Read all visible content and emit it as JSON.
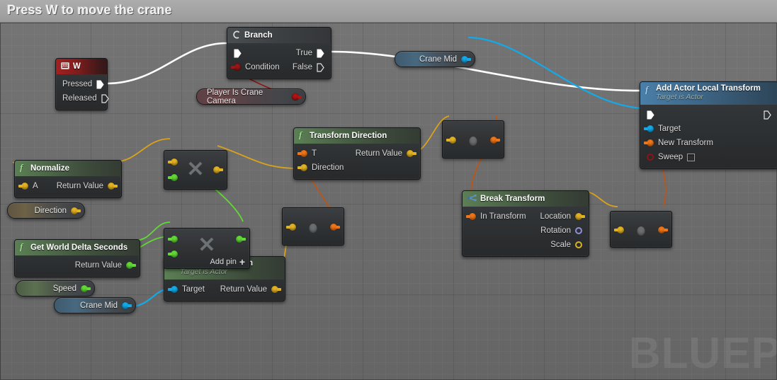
{
  "window": {
    "title": "Press W to move the crane"
  },
  "canvas": {
    "watermark": "BLUEP"
  },
  "palette": {
    "exec_white": "#ffffff",
    "bool_red": "#9c1616",
    "vector_yellow": "#e3b223",
    "float_green": "#62d936",
    "object_blue": "#14a9e8",
    "transform_orange": "#ef7518",
    "rotator_purple": "#8f8fd8",
    "node_header_green": "#5c7f55",
    "node_header_blue": "#4a7fa8",
    "node_header_red": "#a32020"
  },
  "nodes": {
    "event_w": {
      "title": "W",
      "icon": "keyboard-icon",
      "outputs": [
        {
          "label": "Pressed",
          "type": "exec",
          "filled": true
        },
        {
          "label": "Released",
          "type": "exec",
          "filled": false
        }
      ]
    },
    "branch": {
      "title": "Branch",
      "icon": "branch-icon",
      "inputs": [
        {
          "label": "",
          "type": "exec",
          "filled": true
        },
        {
          "label": "Condition",
          "type": "bool"
        }
      ],
      "outputs": [
        {
          "label": "True",
          "type": "exec",
          "filled": true
        },
        {
          "label": "False",
          "type": "exec",
          "filled": false
        }
      ]
    },
    "player_is_crane_camera": {
      "label": "Player Is Crane Camera",
      "type": "bool"
    },
    "crane_mid_top": {
      "label": "Crane Mid",
      "type": "object"
    },
    "crane_mid_bottom": {
      "label": "Crane Mid",
      "type": "object"
    },
    "add_actor_local_transform": {
      "title": "Add Actor Local Transform",
      "subtitle": "Target is Actor",
      "icon": "function-icon",
      "inputs": [
        {
          "label": "",
          "type": "exec",
          "filled": true
        },
        {
          "label": "Target",
          "type": "object"
        },
        {
          "label": "New Transform",
          "type": "transform"
        },
        {
          "label": "Sweep",
          "type": "bool-ring",
          "checkbox": true,
          "checked": false
        }
      ],
      "outputs": [
        {
          "label": "",
          "type": "exec",
          "filled": false
        }
      ]
    },
    "normalize": {
      "title": "Normalize",
      "icon": "function-icon",
      "inputs": [
        {
          "label": "A",
          "type": "vector"
        }
      ],
      "outputs": [
        {
          "label": "Return Value",
          "type": "vector"
        }
      ]
    },
    "direction_var": {
      "label": "Direction",
      "type": "vector"
    },
    "get_world_delta_seconds": {
      "title": "Get World Delta Seconds",
      "icon": "function-icon",
      "outputs": [
        {
          "label": "Return Value",
          "type": "float"
        }
      ]
    },
    "speed_var": {
      "label": "Speed",
      "type": "float"
    },
    "get_actor_location": {
      "title": "Get Actor Location",
      "subtitle": "Target is Actor",
      "icon": "function-icon",
      "inputs": [
        {
          "label": "Target",
          "type": "object"
        }
      ],
      "outputs": [
        {
          "label": "Return Value",
          "type": "vector"
        }
      ]
    },
    "transform_direction": {
      "title": "Transform Direction",
      "icon": "function-icon",
      "inputs": [
        {
          "label": "T",
          "type": "transform"
        },
        {
          "label": "Direction",
          "type": "vector"
        }
      ],
      "outputs": [
        {
          "label": "Return Value",
          "type": "vector"
        }
      ]
    },
    "break_transform": {
      "title": "Break Transform",
      "icon": "break-icon",
      "inputs": [
        {
          "label": "In Transform",
          "type": "transform"
        }
      ],
      "outputs": [
        {
          "label": "Location",
          "type": "vector"
        },
        {
          "label": "Rotation",
          "type": "rotator-ring"
        },
        {
          "label": "Scale",
          "type": "vector-ring"
        }
      ]
    },
    "multiply_vector": {
      "glyph": "✕",
      "inputs": [
        "vector",
        "float"
      ],
      "outputs": [
        "vector"
      ]
    },
    "multiply_float": {
      "glyph": "✕",
      "add_pin_label": "Add pin",
      "add_pin_plus": "➕",
      "inputs": [
        "float",
        "float"
      ],
      "outputs": [
        "float"
      ]
    },
    "collapsed_a": {
      "inputs": [
        "vector"
      ],
      "outputs": [
        "transform"
      ]
    },
    "collapsed_b": {
      "inputs": [
        "vector"
      ],
      "outputs": [
        "transform"
      ]
    },
    "collapsed_c": {
      "inputs": [
        "vector"
      ],
      "outputs": [
        "transform"
      ]
    },
    "collapsed_d": {
      "inputs": [
        "vector"
      ],
      "outputs": [
        "transform"
      ]
    }
  }
}
